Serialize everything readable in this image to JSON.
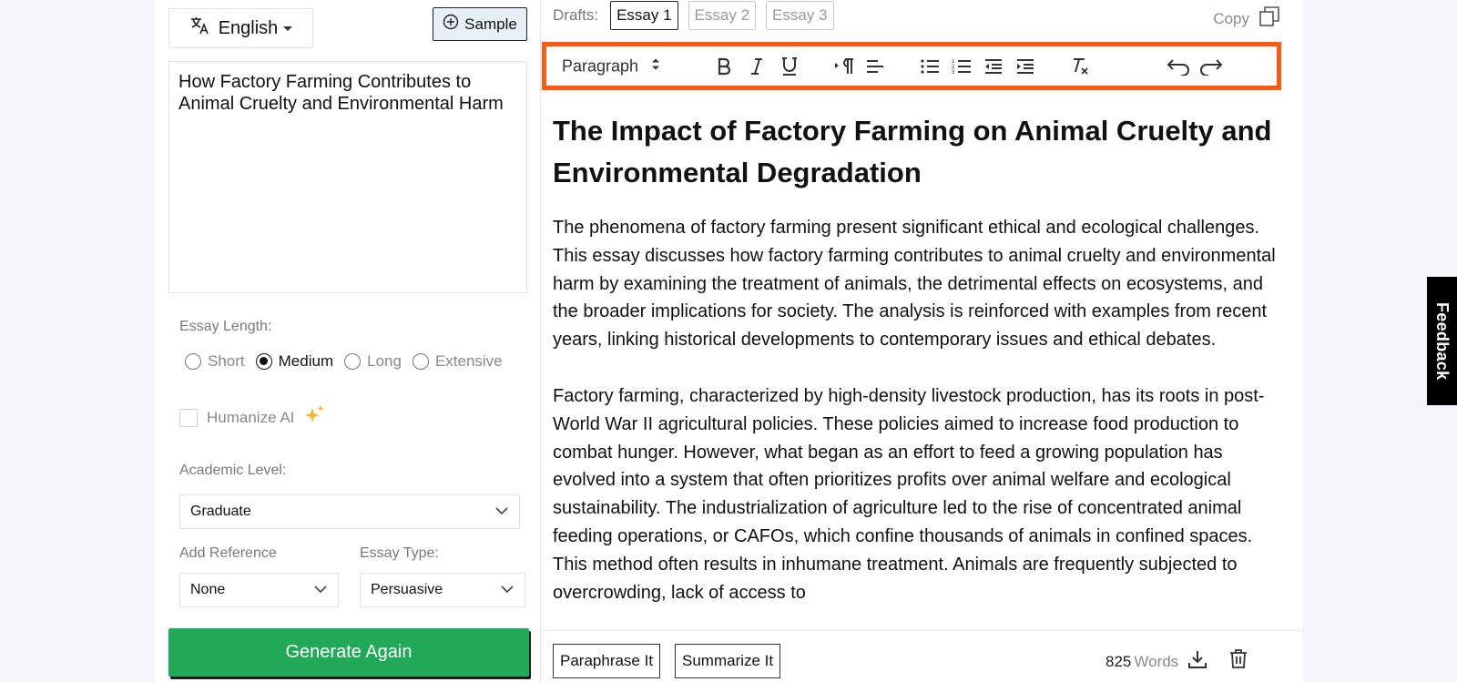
{
  "language": {
    "label": "English"
  },
  "sample_button": {
    "label": "Sample"
  },
  "topic": {
    "value": "How Factory Farming Contributes to Animal Cruelty and Environmental Harm"
  },
  "essay_length": {
    "label": "Essay Length:",
    "options": [
      "Short",
      "Medium",
      "Long",
      "Extensive"
    ],
    "selected": "Medium"
  },
  "humanize": {
    "label": "Humanize AI",
    "checked": false
  },
  "academic_level": {
    "label": "Academic Level:",
    "value": "Graduate"
  },
  "add_reference": {
    "label": "Add Reference",
    "value": "None"
  },
  "essay_type": {
    "label": "Essay Type:",
    "value": "Persuasive"
  },
  "generate_button": {
    "label": "Generate Again",
    "color": "#20a957"
  },
  "drafts": {
    "label": "Drafts:",
    "tabs": [
      "Essay 1",
      "Essay 2",
      "Essay 3"
    ],
    "active": "Essay 1"
  },
  "copy": {
    "label": "Copy"
  },
  "toolbar": {
    "paragraph_label": "Paragraph",
    "highlight_color": "#ff5a14",
    "icons": [
      "bold-icon",
      "italic-icon",
      "underline-icon",
      "text-direction-icon",
      "align-left-icon",
      "bullet-list-icon",
      "numbered-list-icon",
      "outdent-icon",
      "indent-icon",
      "clear-format-icon",
      "undo-icon",
      "redo-icon"
    ]
  },
  "essay": {
    "title": "The Impact of Factory Farming on Animal Cruelty and Environmental Degradation",
    "paragraphs": [
      "The phenomena of factory farming present significant ethical and ecological challenges. This essay discusses how factory farming contributes to animal cruelty and environmental harm by examining the treatment of animals, the detrimental effects on ecosystems, and the broader implications for society. The analysis is reinforced with examples from recent years, linking historical developments to contemporary issues and ethical debates.",
      "Factory farming, characterized by high-density livestock production, has its roots in post-World War II agricultural policies. These policies aimed to increase food production to combat hunger. However, what began as an effort to feed a growing population has evolved into a system that often prioritizes profits over animal welfare and ecological sustainability. The industrialization of agriculture led to the rise of concentrated animal feeding operations, or CAFOs, which confine thousands of animals in confined spaces. This method often results in inhumane treatment. Animals are frequently subjected to overcrowding, lack of access to"
    ]
  },
  "bottom": {
    "paraphrase_label": "Paraphrase It",
    "summarize_label": "Summarize It",
    "word_count": "825",
    "words_label": "Words"
  },
  "feedback": {
    "label": "Feedback"
  }
}
